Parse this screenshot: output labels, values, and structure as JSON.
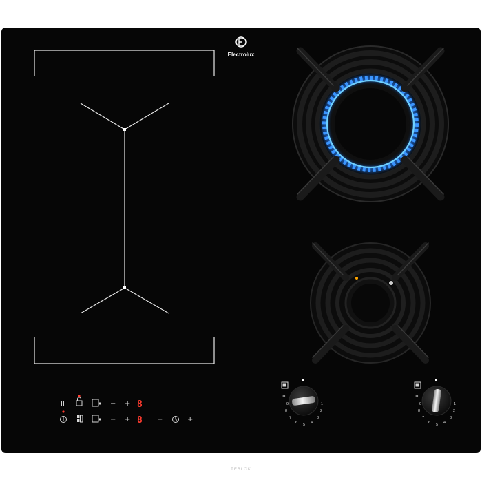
{
  "product": {
    "brand": "Electrolux",
    "watermark": "TEBLOK"
  },
  "colors": {
    "glass": "#060606",
    "flame": "#1e7bff",
    "flame_core": "#6fd0ff",
    "indicator_red": "#ff3b2f",
    "zone_line": "#e8e8e8",
    "grate": "#151515"
  },
  "touch_controls": {
    "row1": {
      "pause_symbol": "II",
      "minus": "−",
      "plus": "+",
      "display": "8"
    },
    "row2": {
      "minus": "−",
      "plus": "+",
      "display": "8",
      "timer_minus": "−",
      "timer_plus": "+"
    }
  },
  "knobs": {
    "scale_numbers": [
      "9",
      "8",
      "7",
      "6",
      "5",
      "4",
      "3",
      "2",
      "1"
    ]
  }
}
